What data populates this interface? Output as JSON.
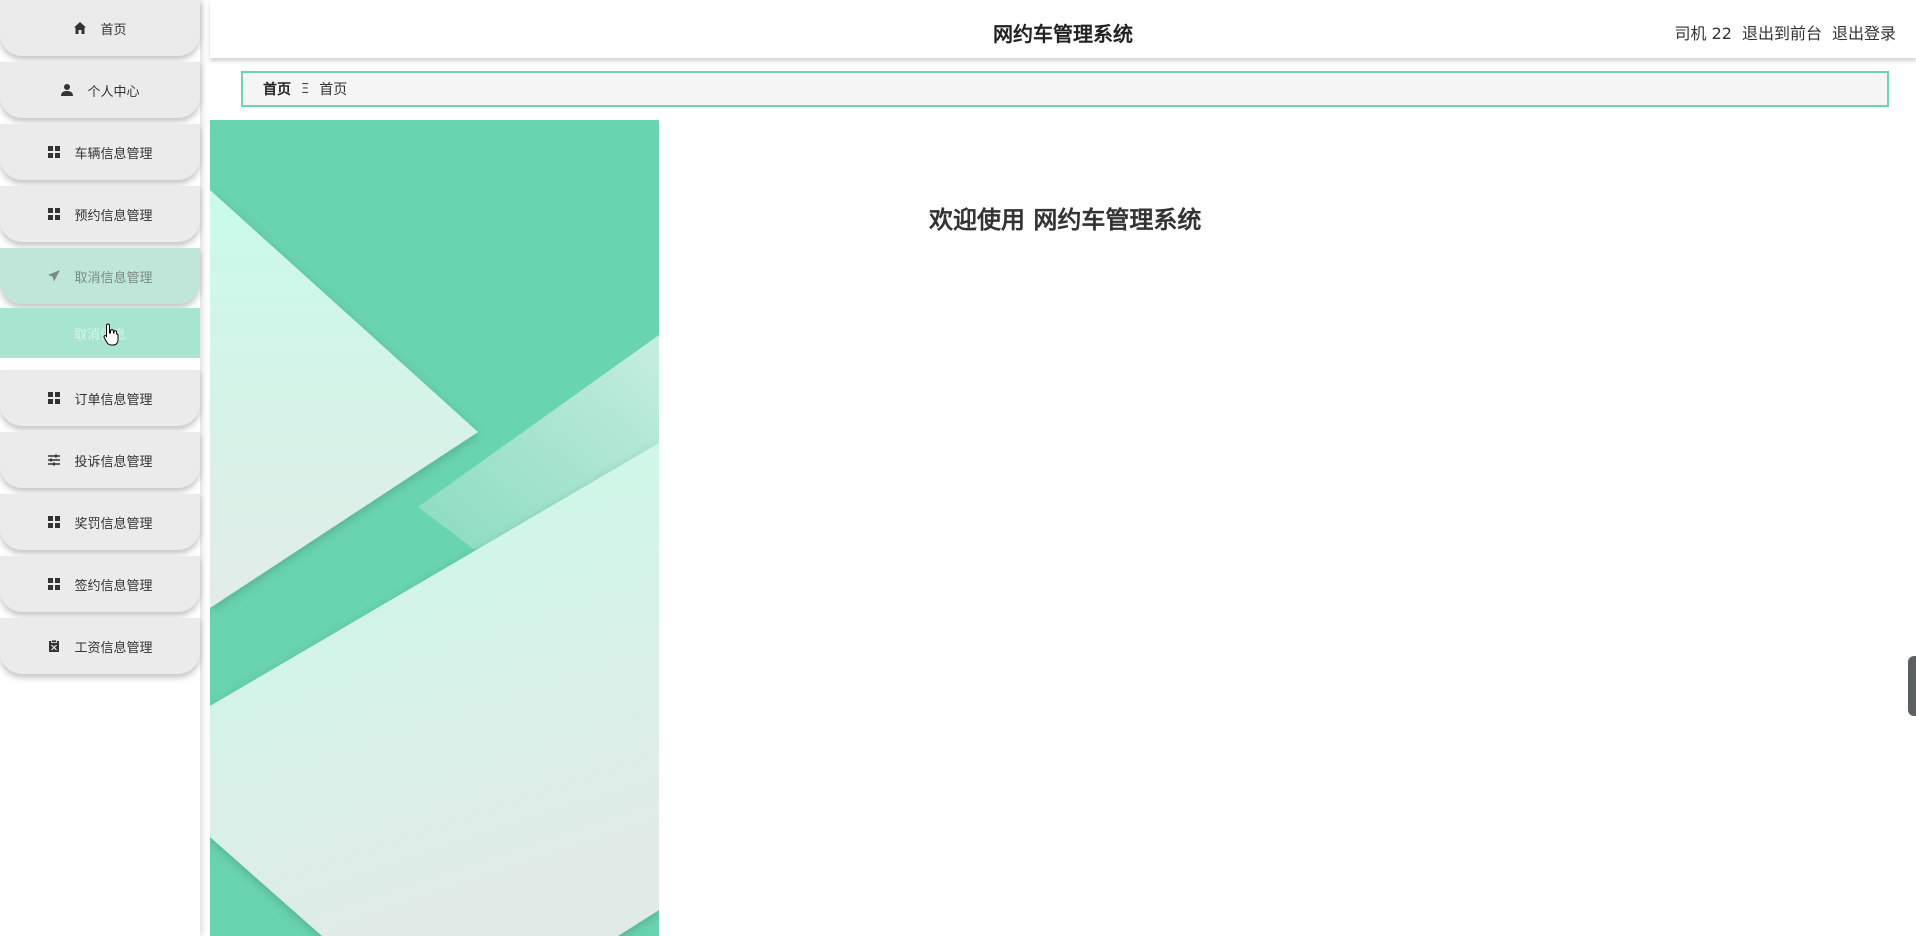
{
  "sidebar": {
    "items": [
      {
        "label": "首页",
        "icon": "home-icon"
      },
      {
        "label": "个人中心",
        "icon": "user-icon"
      },
      {
        "label": "车辆信息管理",
        "icon": "grid-icon"
      },
      {
        "label": "预约信息管理",
        "icon": "grid-icon"
      },
      {
        "label": "取消信息管理",
        "icon": "send-icon"
      },
      {
        "label": "订单信息管理",
        "icon": "grid-icon"
      },
      {
        "label": "投诉信息管理",
        "icon": "sliders-icon"
      },
      {
        "label": "奖罚信息管理",
        "icon": "grid-icon"
      },
      {
        "label": "签约信息管理",
        "icon": "grid-icon"
      },
      {
        "label": "工资信息管理",
        "icon": "clipboard-icon"
      }
    ],
    "submenu": {
      "label": "取消信息"
    }
  },
  "header": {
    "title": "网约车管理系统",
    "user": "司机 22",
    "front_link": "退出到前台",
    "logout": "退出登录"
  },
  "breadcrumb": {
    "home": "首页",
    "separator": "Ξ",
    "current": "首页"
  },
  "main": {
    "welcome": "欢迎使用 网约车管理系统"
  },
  "colors": {
    "accent": "#69d4b0",
    "menu_bg": "#ebebeb",
    "menu_active": "#bfe6d9",
    "submenu_bg": "#a8e5d0"
  }
}
